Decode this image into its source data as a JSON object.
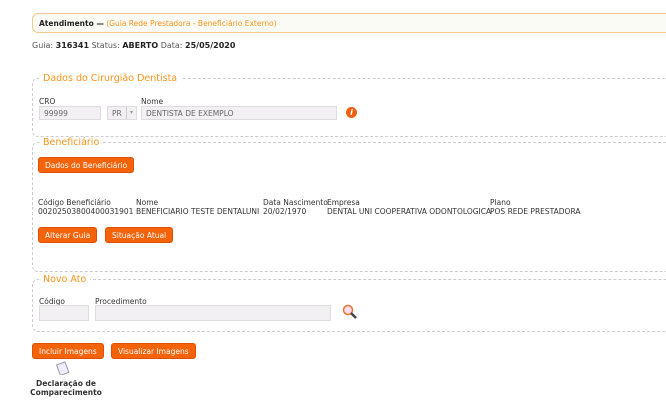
{
  "header": {
    "title": "Atendimento —",
    "subtitle": "(Guia Rede Prestadora - Beneficiário Externo)"
  },
  "info": {
    "guia_label": "Guia:",
    "guia": "316341",
    "status_label": "Status:",
    "status": "ABERTO",
    "data_label": "Data:",
    "data": "25/05/2020"
  },
  "dentista": {
    "legend": "Dados do Cirurgião Dentista",
    "cro_label": "CRO",
    "cro": "99999",
    "uf": "PR",
    "nome_label": "Nome",
    "nome": "DENTISTA DE EXEMPLO"
  },
  "beneficiario": {
    "legend": "Beneficiário",
    "dados_button": "Dados do Beneficiário",
    "cols": [
      {
        "label": "Código Beneficiário",
        "value": "0020250380040003190​1"
      },
      {
        "label": "Nome",
        "value": "BENEFICIARIO TESTE DENTALUNI"
      },
      {
        "label": "Data Nascimento",
        "value": "20/02/1970"
      },
      {
        "label": "Empresa",
        "value": "DENTAL UNI COOPERATIVA ODONTOLOGICA"
      },
      {
        "label": "Plano",
        "value": "POS REDE PRESTADORA"
      }
    ],
    "alterar_button": "Alterar Guia",
    "situacao_button": "Situação Atual"
  },
  "novo_ato": {
    "legend": "Novo Ato",
    "codigo_label": "Código",
    "procedimento_label": "Procedimento"
  },
  "actions": {
    "incluir": "Incluir Imagens",
    "visualizar": "Visualizar Imagens",
    "declaracao_line1": "Declaração de",
    "declaracao_line2": "Comparecimento"
  }
}
